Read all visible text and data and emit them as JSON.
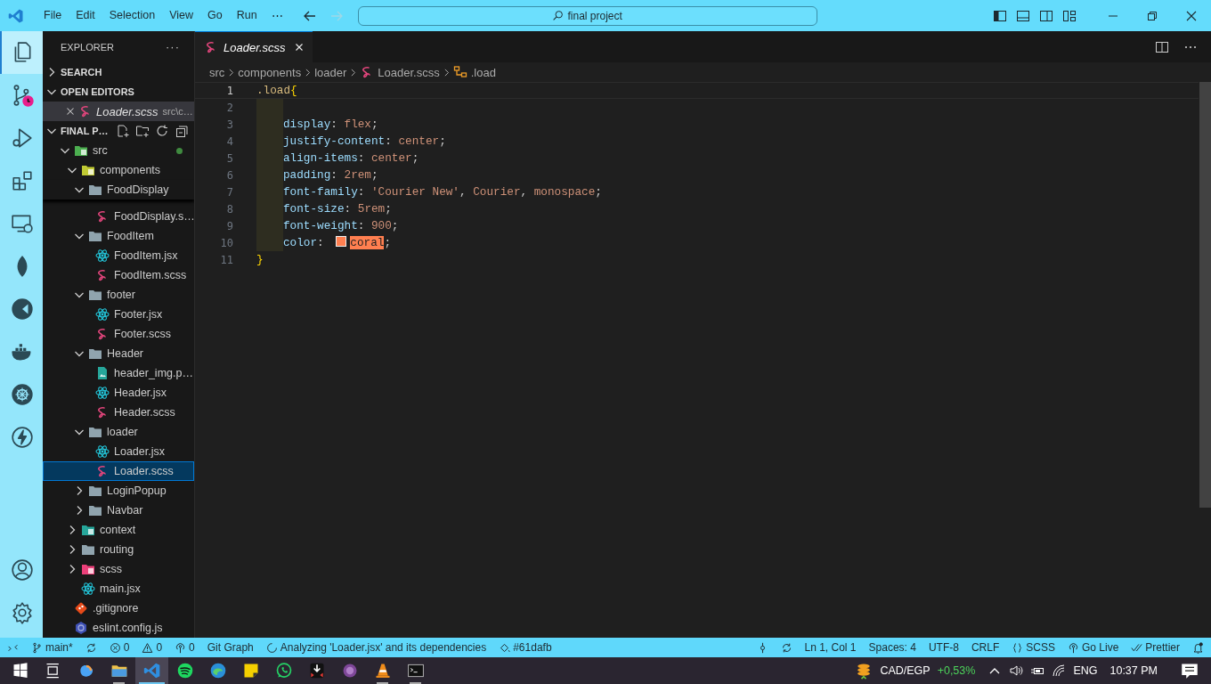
{
  "title_bar": {
    "menu": [
      "File",
      "Edit",
      "Selection",
      "View",
      "Go",
      "Run",
      "⋯"
    ],
    "search": "final project"
  },
  "activity_bar": {
    "top": [
      {
        "kind": "files",
        "selected": true
      },
      {
        "kind": "source-control",
        "selected": false
      },
      {
        "kind": "run-debug",
        "selected": false
      },
      {
        "kind": "extensions",
        "selected": false
      },
      {
        "kind": "remote",
        "selected": false
      },
      {
        "kind": "leaf",
        "selected": false
      },
      {
        "kind": "pie",
        "selected": false
      },
      {
        "kind": "whale",
        "selected": false
      },
      {
        "kind": "helm",
        "selected": false
      },
      {
        "kind": "bolt",
        "selected": false
      }
    ],
    "bottom": [
      {
        "kind": "account",
        "selected": false
      },
      {
        "kind": "settings",
        "selected": false
      }
    ]
  },
  "sidebar": {
    "title": "EXPLORER",
    "more": "···",
    "sections": [
      {
        "label": "SEARCH",
        "expanded": false
      },
      {
        "label": "OPEN EDITORS",
        "expanded": true
      }
    ],
    "open_editors": [
      {
        "name": "Loader.scss",
        "path": "src\\c…",
        "kind": "scss"
      }
    ],
    "root": {
      "label": "FINAL P…",
      "expanded": true
    },
    "tree": [
      {
        "label": "src",
        "kind": "folder-src",
        "expanded": true,
        "modified": true,
        "selected": false,
        "children": [
          {
            "label": "components",
            "kind": "folder-components",
            "expanded": true,
            "selected": false,
            "children": [
              {
                "label": "FoodDisplay",
                "kind": "folder",
                "expanded": true,
                "sticky": true,
                "selected": false,
                "children": [
                  {
                    "label": "FoodDisplay.s…",
                    "kind": "scss",
                    "selected": false
                  }
                ]
              },
              {
                "label": "FoodItem",
                "kind": "folder",
                "expanded": true,
                "selected": false,
                "children": [
                  {
                    "label": "FoodItem.jsx",
                    "kind": "react",
                    "selected": false
                  },
                  {
                    "label": "FoodItem.scss",
                    "kind": "scss",
                    "selected": false
                  }
                ]
              },
              {
                "label": "footer",
                "kind": "folder",
                "expanded": true,
                "selected": false,
                "children": [
                  {
                    "label": "Footer.jsx",
                    "kind": "react",
                    "selected": false
                  },
                  {
                    "label": "Footer.scss",
                    "kind": "scss",
                    "selected": false
                  }
                ]
              },
              {
                "label": "Header",
                "kind": "folder",
                "expanded": true,
                "selected": false,
                "children": [
                  {
                    "label": "header_img.p…",
                    "kind": "image",
                    "selected": false
                  },
                  {
                    "label": "Header.jsx",
                    "kind": "react",
                    "selected": false
                  },
                  {
                    "label": "Header.scss",
                    "kind": "scss",
                    "selected": false
                  }
                ]
              },
              {
                "label": "loader",
                "kind": "folder",
                "expanded": true,
                "selected": false,
                "children": [
                  {
                    "label": "Loader.jsx",
                    "kind": "react",
                    "selected": false
                  },
                  {
                    "label": "Loader.scss",
                    "kind": "scss",
                    "selected": true
                  }
                ]
              },
              {
                "label": "LoginPopup",
                "kind": "folder",
                "expanded": false,
                "selected": false
              },
              {
                "label": "Navbar",
                "kind": "folder",
                "expanded": false,
                "selected": false
              }
            ]
          },
          {
            "label": "context",
            "kind": "folder-context",
            "expanded": false,
            "selected": false
          },
          {
            "label": "routing",
            "kind": "folder",
            "expanded": false,
            "selected": false
          },
          {
            "label": "scss",
            "kind": "folder-scss",
            "expanded": false,
            "selected": false
          },
          {
            "label": "main.jsx",
            "kind": "react",
            "selected": false
          }
        ]
      },
      {
        "label": ".gitignore",
        "kind": "git",
        "selected": false
      },
      {
        "label": "eslint.config.js",
        "kind": "eslint",
        "selected": false
      }
    ]
  },
  "editor": {
    "tabs": [
      {
        "name": "Loader.scss",
        "kind": "scss",
        "preview": true,
        "selected": true
      }
    ],
    "breadcrumbs": [
      {
        "text": "src",
        "kind": "folder"
      },
      {
        "text": "components",
        "kind": "folder"
      },
      {
        "text": "loader",
        "kind": "folder"
      },
      {
        "text": "Loader.scss",
        "kind": "scss"
      },
      {
        "text": ".load",
        "kind": "symbol"
      }
    ],
    "lines": [
      {
        "number": "1",
        "current": true,
        "indent": false,
        "tokens": [
          {
            "text": ".load",
            "kind": "selector"
          },
          {
            "text": "{",
            "kind": "brace"
          }
        ]
      },
      {
        "number": "2",
        "current": false,
        "indent": true
      },
      {
        "number": "3",
        "current": false,
        "indent": true,
        "tokens": [
          {
            "text": "display",
            "kind": "property"
          },
          {
            "text": ": ",
            "kind": "punct"
          },
          {
            "text": "flex",
            "kind": "value"
          },
          {
            "text": ";",
            "kind": "punct"
          }
        ]
      },
      {
        "number": "4",
        "current": false,
        "indent": true,
        "tokens": [
          {
            "text": "justify-content",
            "kind": "property"
          },
          {
            "text": ": ",
            "kind": "punct"
          },
          {
            "text": "center",
            "kind": "value"
          },
          {
            "text": ";",
            "kind": "punct"
          }
        ]
      },
      {
        "number": "5",
        "current": false,
        "indent": true,
        "tokens": [
          {
            "text": "align-items",
            "kind": "property"
          },
          {
            "text": ": ",
            "kind": "punct"
          },
          {
            "text": "center",
            "kind": "value"
          },
          {
            "text": ";",
            "kind": "punct"
          }
        ]
      },
      {
        "number": "6",
        "current": false,
        "indent": true,
        "tokens": [
          {
            "text": "padding",
            "kind": "property"
          },
          {
            "text": ": ",
            "kind": "punct"
          },
          {
            "text": "2rem",
            "kind": "value"
          },
          {
            "text": ";",
            "kind": "punct"
          }
        ]
      },
      {
        "number": "7",
        "current": false,
        "indent": true,
        "tokens": [
          {
            "text": "font-family",
            "kind": "property"
          },
          {
            "text": ": ",
            "kind": "punct"
          },
          {
            "text": "'Courier New'",
            "kind": "string"
          },
          {
            "text": ", ",
            "kind": "punct"
          },
          {
            "text": "Courier",
            "kind": "value"
          },
          {
            "text": ", ",
            "kind": "punct"
          },
          {
            "text": "monospace",
            "kind": "value"
          },
          {
            "text": ";",
            "kind": "punct"
          }
        ]
      },
      {
        "number": "8",
        "current": false,
        "indent": true,
        "tokens": [
          {
            "text": "font-size",
            "kind": "property"
          },
          {
            "text": ": ",
            "kind": "punct"
          },
          {
            "text": "5rem",
            "kind": "value"
          },
          {
            "text": ";",
            "kind": "punct"
          }
        ]
      },
      {
        "number": "9",
        "current": false,
        "indent": true,
        "tokens": [
          {
            "text": "font-weight",
            "kind": "property"
          },
          {
            "text": ": ",
            "kind": "punct"
          },
          {
            "text": "900",
            "kind": "value"
          },
          {
            "text": ";",
            "kind": "punct"
          }
        ]
      },
      {
        "number": "10",
        "current": false,
        "indent": true,
        "tokens": [
          {
            "text": "color",
            "kind": "property"
          },
          {
            "text": ": ",
            "kind": "punct"
          },
          {
            "text": "coral",
            "kind": "color",
            "color": "#ff7f50"
          },
          {
            "text": ";",
            "kind": "punct"
          }
        ]
      },
      {
        "number": "11",
        "current": false,
        "indent": false,
        "tokens": [
          {
            "text": "}",
            "kind": "brace"
          }
        ]
      }
    ]
  },
  "status_bar": {
    "left": [
      {
        "kind": "remote"
      },
      {
        "kind": "branch",
        "text": "main*"
      },
      {
        "kind": "sync"
      },
      {
        "kind": "error",
        "text": "0"
      },
      {
        "kind": "warning",
        "text": "0"
      },
      {
        "kind": "broadcast",
        "text": "0"
      },
      {
        "kind": "plain",
        "text": "Git Graph"
      },
      {
        "kind": "spinner",
        "text": "Analyzing 'Loader.jsx' and its dependencies"
      },
      {
        "kind": "bucket",
        "text": "#61dafb"
      }
    ],
    "right": [
      {
        "kind": "commit"
      },
      {
        "kind": "sync"
      },
      {
        "kind": "plain",
        "text": "Ln 1, Col 1"
      },
      {
        "kind": "plain",
        "text": "Spaces: 4"
      },
      {
        "kind": "plain",
        "text": "UTF-8"
      },
      {
        "kind": "plain",
        "text": "CRLF"
      },
      {
        "kind": "braces",
        "text": "SCSS"
      },
      {
        "kind": "broadcast",
        "text": "Go Live"
      },
      {
        "kind": "checks",
        "text": "Prettier"
      },
      {
        "kind": "bell"
      }
    ]
  },
  "taskbar": {
    "apps": [
      {
        "kind": "start",
        "open": false,
        "selected": false
      },
      {
        "kind": "task-view",
        "open": false,
        "selected": false
      },
      {
        "kind": "copilot",
        "open": false,
        "selected": false
      },
      {
        "kind": "folder",
        "open": true,
        "selected": false
      },
      {
        "kind": "code",
        "open": true,
        "selected": true
      },
      {
        "kind": "spotify",
        "open": false,
        "selected": false
      },
      {
        "kind": "edge",
        "open": false,
        "selected": false
      },
      {
        "kind": "notes",
        "open": false,
        "selected": false
      },
      {
        "kind": "whatsapp",
        "open": false,
        "selected": false
      },
      {
        "kind": "download",
        "open": false,
        "selected": false
      },
      {
        "kind": "tor",
        "open": false,
        "selected": false
      },
      {
        "kind": "cone",
        "open": true,
        "selected": false
      },
      {
        "kind": "terminal",
        "open": true,
        "selected": false
      }
    ],
    "ticker": {
      "label": "CAD/EGP",
      "change": "+0,53%"
    },
    "language": "ENG",
    "time": "10:37 PM"
  }
}
